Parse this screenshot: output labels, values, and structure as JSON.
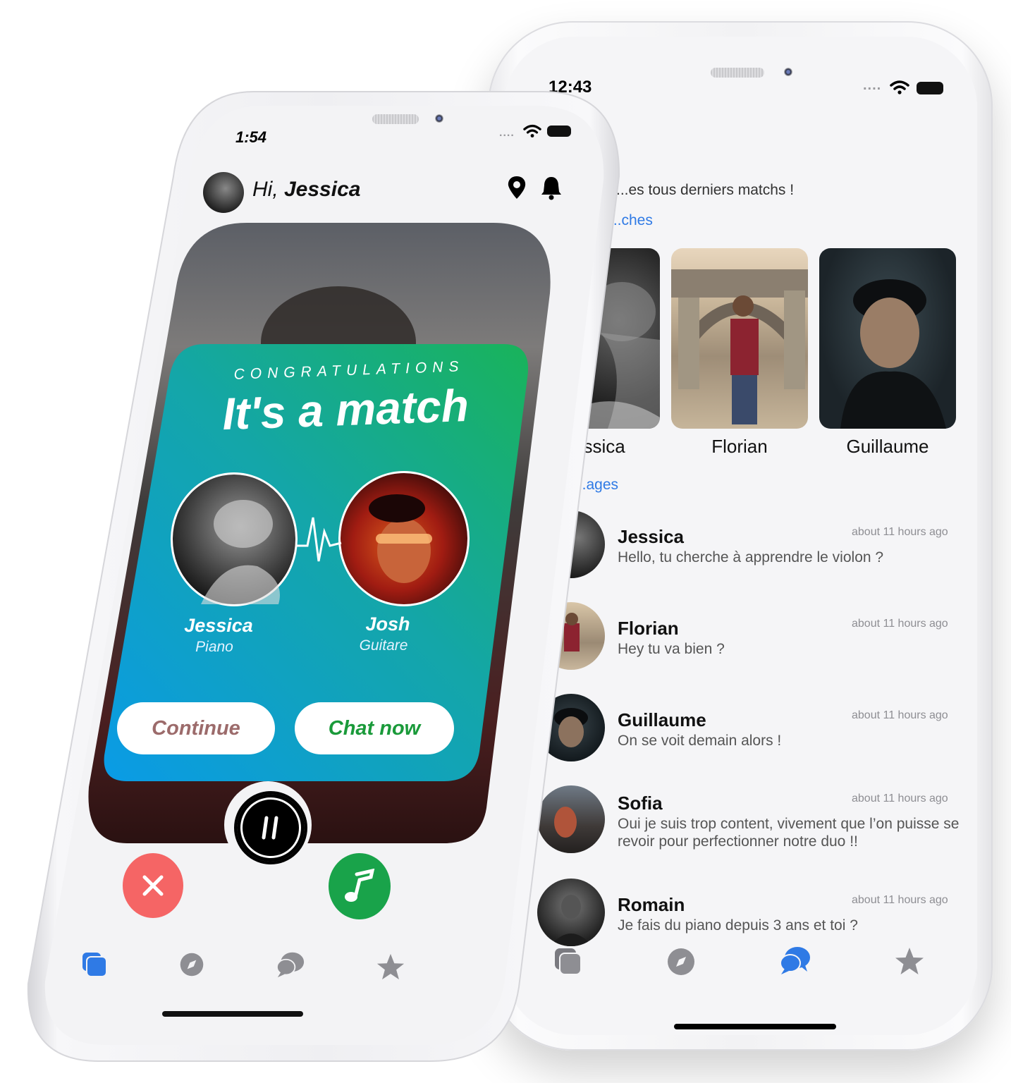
{
  "colors": {
    "accent_blue": "#2f7ae5",
    "match_gradient_start": "#0a9be6",
    "match_gradient_end": "#19b35a",
    "dislike_red": "#f56565",
    "like_green": "#19a34a",
    "continue_text": "#9c6b6b",
    "chat_now_text": "#1a9a3a"
  },
  "front_phone": {
    "status_time": "1:54",
    "status_dots": "....",
    "greeting_prefix": "Hi, ",
    "greeting_name": "Jessica",
    "header_icons": [
      "location-pin-icon",
      "bell-icon"
    ],
    "match_popup": {
      "congrats": "CONGRATULATIONS",
      "title": "It's a match",
      "left_user": {
        "name": "Jessica",
        "instrument": "Piano"
      },
      "right_user": {
        "name": "Josh",
        "instrument": "Guitare"
      },
      "continue_label": "Continue",
      "chat_label": "Chat now"
    },
    "actions": [
      "close-icon",
      "pause-icon",
      "music-note-icon"
    ],
    "tabs": [
      "cards-icon",
      "compass-icon",
      "chat-bubbles-icon",
      "star-icon"
    ],
    "active_tab": "cards-icon"
  },
  "back_phone": {
    "status_time": "12:43",
    "status_dots": "....",
    "subtitle": "...es tous derniers matchs !",
    "matches_section": "...ches",
    "matches": [
      {
        "name": "...essica"
      },
      {
        "name": "Florian"
      },
      {
        "name": "Guillaume"
      }
    ],
    "messages_section": "...ages",
    "messages": [
      {
        "name": "Jessica",
        "text": "Hello, tu cherche à apprendre le violon ?",
        "time": "about 11 hours ago"
      },
      {
        "name": "Florian",
        "text": "Hey tu va bien ?",
        "time": "about 11 hours ago"
      },
      {
        "name": "Guillaume",
        "text": "On se voit demain alors !",
        "time": "about 11 hours ago"
      },
      {
        "name": "Sofia",
        "text": "Oui je suis trop content, vivement que l’on puisse se revoir pour perfectionner notre duo !!",
        "time": "about 11 hours ago"
      },
      {
        "name": "Romain",
        "text": "Je fais du piano depuis 3 ans et toi ?",
        "time": "about 11 hours ago"
      }
    ],
    "tabs": [
      "cards-icon",
      "compass-icon",
      "chat-bubbles-icon",
      "star-icon"
    ],
    "active_tab": "chat-bubbles-icon"
  }
}
